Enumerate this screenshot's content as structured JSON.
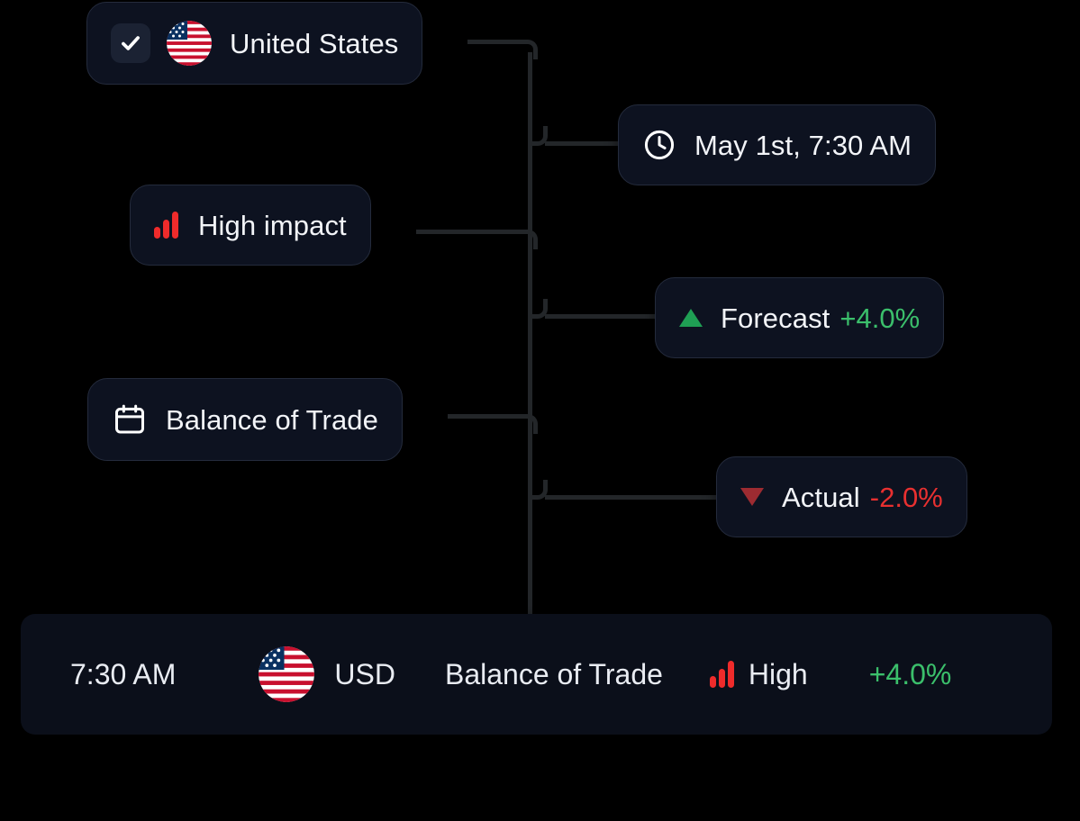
{
  "nodes": {
    "country": {
      "label": "United States",
      "checkbox_checked": true,
      "checkbox_icon": "check-icon",
      "flag_icon": "us-flag-icon"
    },
    "datetime": {
      "label": "May 1st, 7:30 AM",
      "icon": "clock-icon"
    },
    "impact": {
      "label": "High impact",
      "icon": "impact-bars-icon",
      "icon_color": "#ef2b2b"
    },
    "forecast": {
      "label": "Forecast",
      "value": "+4.0%",
      "icon": "triangle-up-icon",
      "value_color": "#3bbf6b",
      "icon_color": "#1f9f54"
    },
    "event": {
      "label": "Balance of Trade",
      "icon": "calendar-icon"
    },
    "actual": {
      "label": "Actual",
      "value": "-2.0%",
      "icon": "triangle-down-icon",
      "value_color": "#e83030",
      "icon_color": "#9d2b31"
    }
  },
  "bottom_bar": {
    "time": "7:30 AM",
    "flag_icon": "us-flag-icon",
    "currency": "USD",
    "event": "Balance of Trade",
    "impact_icon": "impact-bars-icon",
    "impact": "High",
    "percent": "+4.0%",
    "percent_color": "#3bbf6b"
  },
  "theme": {
    "page_bg": "#000000",
    "node_bg": "#0d1220",
    "node_border": "#242b3c",
    "bar_bg": "#0b0f1a",
    "connector": "#232629",
    "text": "#f2f4f8"
  }
}
